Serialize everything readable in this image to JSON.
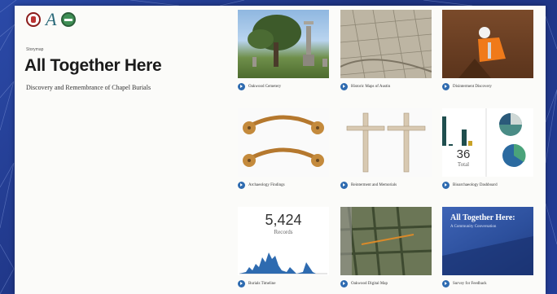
{
  "header": {
    "kicker": "Storymap",
    "title": "All Together Here",
    "subtitle": "Discovery and Remembrance of Chapel Burials"
  },
  "cards": [
    {
      "caption": "Oakwood Cemetery",
      "icon": "chevron-right-icon"
    },
    {
      "caption": "Historic Maps of Austin",
      "icon": "chevron-right-icon"
    },
    {
      "caption": "Disinterment Discovery",
      "icon": "chevron-right-icon"
    },
    {
      "caption": "Archaeology Findings",
      "icon": "chevron-right-icon"
    },
    {
      "caption": "Reinterment and Memorials",
      "icon": "chevron-right-icon"
    },
    {
      "caption": "Bioarchaeology Dashboard",
      "icon": "chevron-right-icon"
    },
    {
      "caption": "Burials Timeline",
      "icon": "chevron-right-icon"
    },
    {
      "caption": "Oakwood Digital Map",
      "icon": "chevron-right-icon"
    },
    {
      "caption": "Survey for Feedback",
      "icon": "chevron-right-icon"
    }
  ],
  "dashboard": {
    "count": "36",
    "count_label": "Total"
  },
  "timeline": {
    "count": "5,424",
    "count_label": "Records"
  },
  "survey_cover": {
    "title": "All Together Here:",
    "subtitle": "A Community Conversation"
  },
  "colors": {
    "accent": "#2e6bb0",
    "background": "#1e3a8a"
  }
}
